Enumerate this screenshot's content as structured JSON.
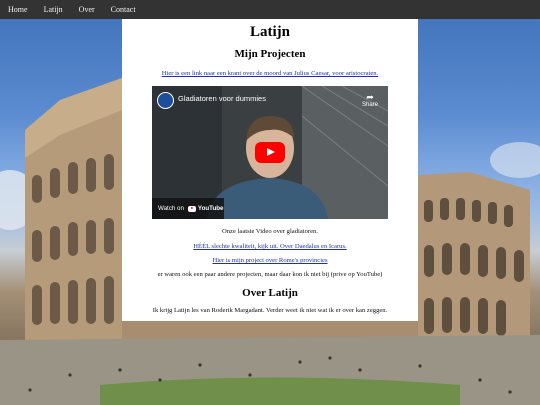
{
  "nav": {
    "items": [
      "Home",
      "Latijn",
      "Over",
      "Contact"
    ]
  },
  "page": {
    "title": "Latijn",
    "projects_heading": "Mijn Projecten",
    "link_krant": "Hier is een link naar een krant over de moord van Julius Caesar, voor aristocraten.",
    "video": {
      "title": "Gladiatoren voor dummies",
      "share_label": "Share",
      "watch_on": "Watch on",
      "brand": "YouTube"
    },
    "video_caption": "Onze laatste Video over gladiatoren.",
    "link_daedalus": "HÉÉL slechte kwaliteit, kijk uit. Over Daedalus en Icarus.",
    "link_provincies": "Hier is mijn project over Rome's provincies",
    "note_more": "er waren ook een paar andere projecten, maar daar kon ik niet bij (prive op YouTube)",
    "about_heading": "Over Latijn",
    "about_text": "Ik krijg Latijn les van Roderik Margadant. Verder weet ik niet wat ik er over kan zeggen."
  },
  "colors": {
    "nav_bg": "#333333",
    "nav_text": "#f2f2f2",
    "link": "#1f2fb5",
    "panel_bg": "#ffffff",
    "play_button": "#ff0000"
  }
}
